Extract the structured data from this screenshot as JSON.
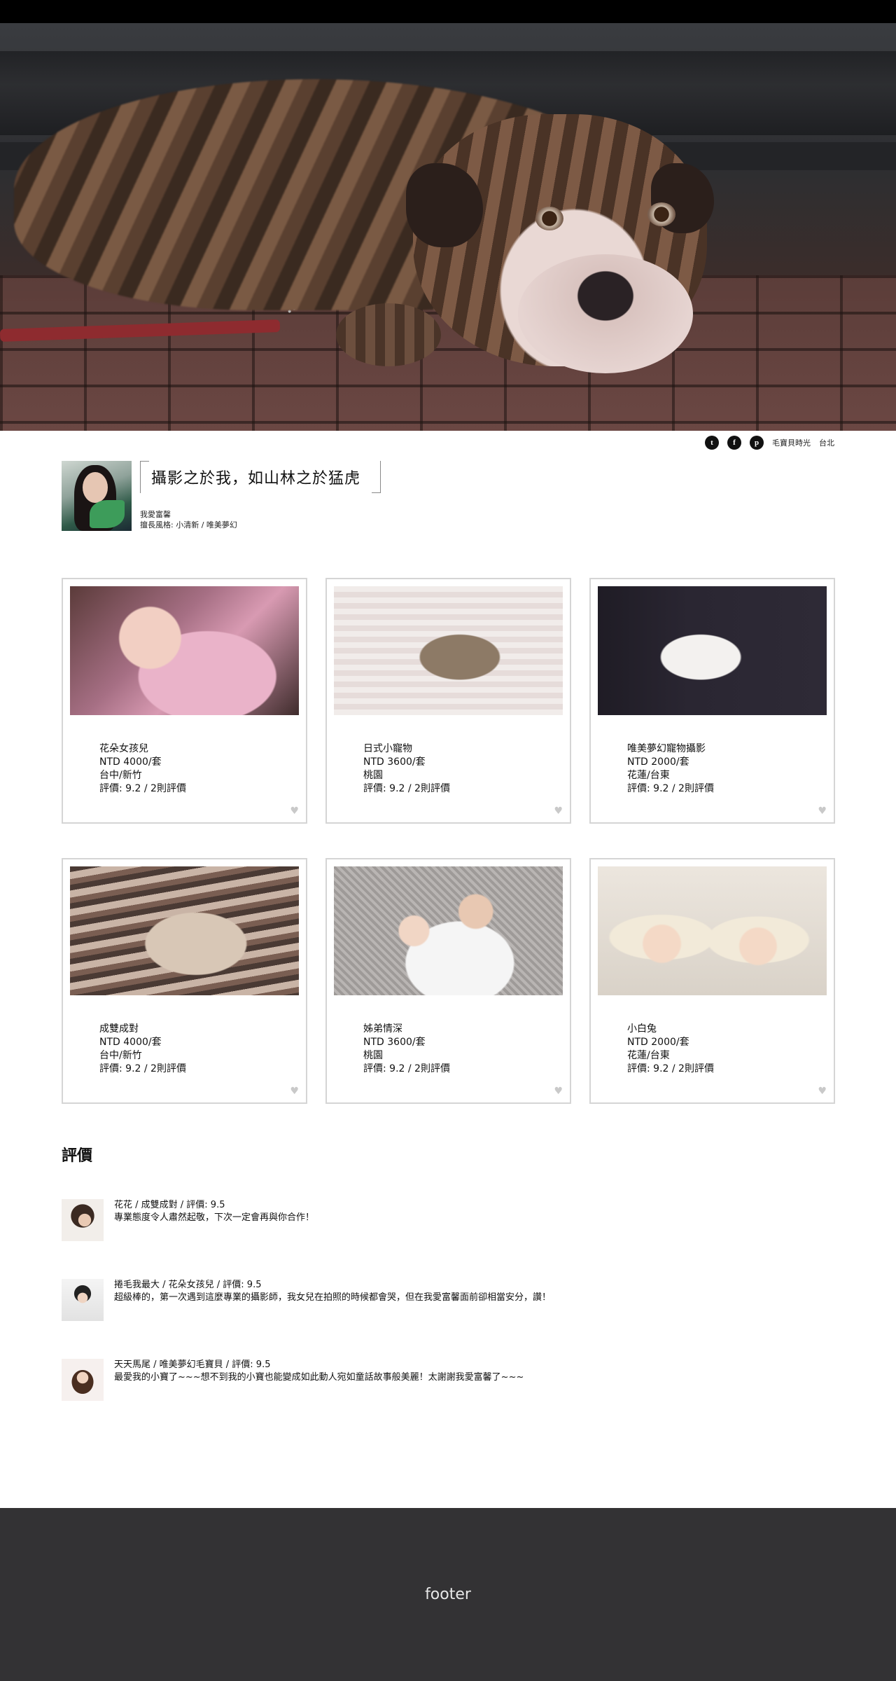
{
  "social": {
    "icons": [
      "twitter-icon",
      "facebook-icon",
      "pinterest-icon"
    ],
    "glyphs": [
      "t",
      "f",
      "p"
    ],
    "brand": "毛寶貝時光",
    "location": "台北"
  },
  "profile": {
    "title": "攝影之於我，如山林之於猛虎",
    "owner_name": "我愛富馨",
    "style": "擅長風格: 小清新 / 唯美夢幻"
  },
  "cards": [
    {
      "name": "花朵女孩兒",
      "price": "NTD 4000/套",
      "location": "台中/新竹",
      "rating": "評價:  9.2 / 2則評價"
    },
    {
      "name": "日式小寵物",
      "price": "NTD 3600/套",
      "location": "桃園",
      "rating": "評價:  9.2 / 2則評價"
    },
    {
      "name": "唯美夢幻寵物攝影",
      "price": "NTD 2000/套",
      "location": "花蓮/台東",
      "rating": "評價:  9.2 / 2則評價"
    },
    {
      "name": "成雙成對",
      "price": "NTD 4000/套",
      "location": "台中/新竹",
      "rating": "評價:  9.2 / 2則評價"
    },
    {
      "name": "姊弟情深",
      "price": "NTD 3600/套",
      "location": "桃園",
      "rating": "評價:  9.2 / 2則評價"
    },
    {
      "name": "小白兔",
      "price": "NTD 2000/套",
      "location": "花蓮/台東",
      "rating": "評價:  9.2 / 2則評價"
    }
  ],
  "reviews": {
    "title": "評價",
    "items": [
      {
        "header": "花花 / 成雙成對 / 評價: 9.5",
        "text": "專業態度令人肅然起敬，下次一定會再與你合作！"
      },
      {
        "header": "捲毛我最大 / 花朵女孩兒 / 評價: 9.5",
        "text": "超級棒的，第一次遇到這麼專業的攝影師，我女兒在拍照的時候都會哭，但在我愛富馨面前卻相當安分，讚！"
      },
      {
        "header": "天天馬尾 / 唯美夢幻毛寶貝 / 評價: 9.5",
        "text": "最愛我的小寶了~~~想不到我的小寶也能變成如此動人宛如童話故事般美麗！太謝謝我愛富馨了~~~"
      }
    ]
  },
  "footer": {
    "label": "footer"
  }
}
